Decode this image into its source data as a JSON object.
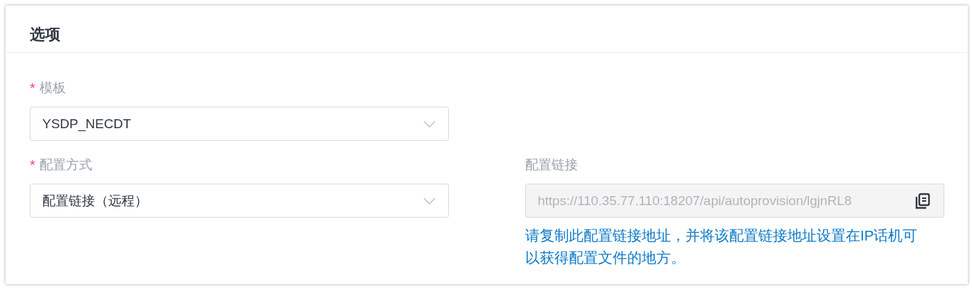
{
  "section": {
    "title": "选项"
  },
  "fields": [
    {
      "kind": "select",
      "label": "模板",
      "required_mark": "*",
      "value": "YSDP_NECDT"
    },
    {
      "kind": "spacer"
    },
    {
      "kind": "select",
      "label": "配置方式",
      "required_mark": "*",
      "value": "配置链接（远程）"
    },
    {
      "kind": "copy",
      "label": "配置链接",
      "value": "https://110.35.77.110:18207/api/autoprovision/lgjnRL8",
      "disabled": true,
      "hint": "请复制此配置链接地址，并将该配置链接地址设置在IP话机可以获得配置文件的地方。"
    }
  ]
}
